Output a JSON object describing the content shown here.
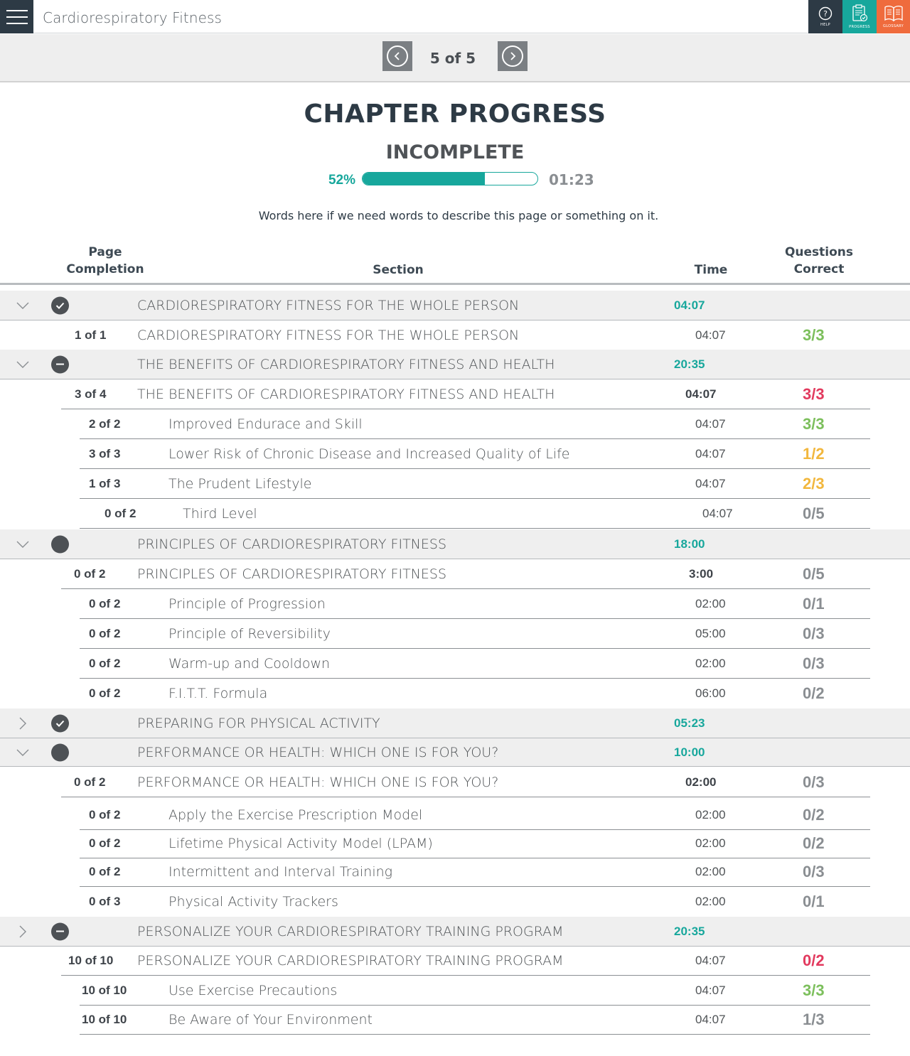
{
  "app": {
    "title": "Cardiorespiratory Fitness"
  },
  "toolbar": {
    "help_label": "HELP",
    "progress_label": "PROGRESS",
    "glossary_label": "GLOSSARY"
  },
  "pager": {
    "current": "5 of  5"
  },
  "header": {
    "title": "CHAPTER PROGRESS",
    "status": "INCOMPLETE",
    "percent_label": "52%",
    "percent_value": 0.7,
    "elapsed": "01:23",
    "description": "Words here if we need words to describe this page or something on it."
  },
  "columns": {
    "completion_line1": "Page",
    "completion_line2": "Completion",
    "section": "Section",
    "time": "Time",
    "questions_line1": "Questions",
    "questions_line2": "Correct"
  },
  "colors": {
    "accent": "#17a79c",
    "green": "#7cbf5c",
    "red": "#e23a5e",
    "yellow": "#f2b73d",
    "gray": "#8a8e92"
  },
  "sections": [
    {
      "title": "CARDIORESPIRATORY FITNESS FOR THE WHOLE PERSON",
      "time": "04:07",
      "expanded": true,
      "status_icon": "check-circle-icon",
      "rows": [
        {
          "completion": "1 of 1",
          "title": "CARDIORESPIRATORY FITNESS FOR THE WHOLE PERSON",
          "time": "04:07",
          "score": "3/3",
          "score_color": "green"
        }
      ]
    },
    {
      "title": "THE BENEFITS OF CARDIORESPIRATORY FITNESS AND HEALTH",
      "time": "20:35",
      "expanded": true,
      "status_icon": "minus-circle-icon",
      "rows": [
        {
          "completion": "3 of 4",
          "title": "THE BENEFITS OF CARDIORESPIRATORY FITNESS AND HEALTH",
          "time": "04:07",
          "score": "3/3",
          "score_color": "red"
        },
        {
          "completion": "2 of 2",
          "title": "Improved Endurace and Skill",
          "time": "04:07",
          "score": "3/3",
          "score_color": "green"
        },
        {
          "completion": "3 of 3",
          "title": "Lower Risk of Chronic Disease and Increased Quality of Life",
          "time": "04:07",
          "score": "1/2",
          "score_color": "yellow"
        },
        {
          "completion": "1 of 3",
          "title": "The Prudent Lifestyle",
          "time": "04:07",
          "score": "2/3",
          "score_color": "yellow"
        },
        {
          "completion": "0 of 2",
          "title": "Third Level",
          "time": "04:07",
          "score": "0/5",
          "score_color": "gray"
        }
      ]
    },
    {
      "title": "PRINCIPLES OF CARDIORESPIRATORY FITNESS",
      "time": "18:00",
      "expanded": true,
      "status_icon": "filled-circle-icon",
      "rows": [
        {
          "completion": "0 of 2",
          "title": "PRINCIPLES OF CARDIORESPIRATORY FITNESS",
          "time": "3:00",
          "score": "0/5",
          "score_color": "gray"
        },
        {
          "completion": "0 of 2",
          "title": "Principle of Progression",
          "time": "02:00",
          "score": "0/1",
          "score_color": "gray"
        },
        {
          "completion": "0 of 2",
          "title": "Principle of Reversibility",
          "time": "05:00",
          "score": "0/3",
          "score_color": "gray"
        },
        {
          "completion": "0 of 2",
          "title": "Warm-up and Cooldown",
          "time": "02:00",
          "score": "0/3",
          "score_color": "gray"
        },
        {
          "completion": "0 of 2",
          "title": "F.I.T.T. Formula",
          "time": "06:00",
          "score": "0/2",
          "score_color": "gray"
        }
      ]
    },
    {
      "title": "PREPARING FOR PHYSICAL ACTIVITY",
      "time": "05:23",
      "expanded": false,
      "status_icon": "check-circle-icon",
      "rows": []
    },
    {
      "title": "PERFORMANCE OR HEALTH: WHICH ONE IS FOR YOU?",
      "time": "10:00",
      "expanded": true,
      "status_icon": "filled-circle-icon",
      "rows": [
        {
          "completion": "0 of 2",
          "title": "PERFORMANCE OR HEALTH: WHICH ONE IS FOR YOU?",
          "time": "02:00",
          "score": "0/3",
          "score_color": "gray"
        },
        {
          "completion": "0 of 2",
          "title": "Apply the Exercise Prescription Model",
          "time": "02:00",
          "score": "0/2",
          "score_color": "gray"
        },
        {
          "completion": "0 of 2",
          "title": "Lifetime Physical Activity Model (LPAM)",
          "time": "02:00",
          "score": "0/2",
          "score_color": "gray"
        },
        {
          "completion": "0 of 2",
          "title": "Intermittent and Interval Training",
          "time": "02:00",
          "score": "0/3",
          "score_color": "gray"
        },
        {
          "completion": "0 of 3",
          "title": "Physical Activity Trackers",
          "time": "02:00",
          "score": "0/1",
          "score_color": "gray"
        }
      ]
    },
    {
      "title": "PERSONALIZE YOUR CARDIORESPIRATORY TRAINING PROGRAM",
      "time": "20:35",
      "expanded": false,
      "status_icon": "minus-circle-icon",
      "rows": [
        {
          "completion": "10 of 10",
          "title": "PERSONALIZE YOUR CARDIORESPIRATORY TRAINING PROGRAM",
          "time": "04:07",
          "score": "0/2",
          "score_color": "red"
        },
        {
          "completion": "10 of 10",
          "title": "Use Exercise Precautions",
          "time": "04:07",
          "score": "3/3",
          "score_color": "green"
        },
        {
          "completion": "10 of 10",
          "title": "Be Aware of Your Environment",
          "time": "04:07",
          "score": "1/3",
          "score_color": "gray"
        }
      ]
    }
  ]
}
